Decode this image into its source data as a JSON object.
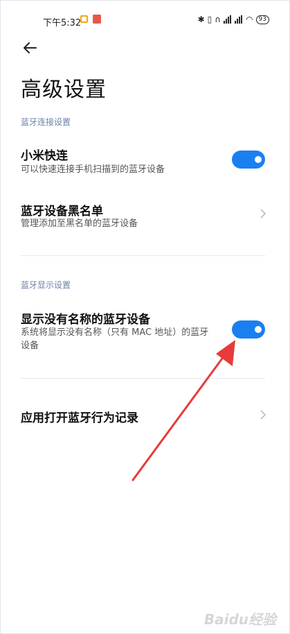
{
  "status_bar": {
    "time": "下午5:32",
    "battery": "93"
  },
  "page": {
    "title": "高级设置"
  },
  "sections": {
    "connect": "蓝牙连接设置",
    "display": "蓝牙显示设置"
  },
  "items": {
    "quick_connect": {
      "title": "小米快连",
      "subtitle": "可以快速连接手机扫描到的蓝牙设备",
      "enabled": true
    },
    "blacklist": {
      "title": "蓝牙设备黑名单",
      "subtitle": "管理添加至黑名单的蓝牙设备"
    },
    "show_unnamed": {
      "title": "显示没有名称的蓝牙设备",
      "subtitle_line1": "系统将显示没有名称（只有 MAC 地址）的蓝牙",
      "subtitle_line2": "设备",
      "enabled": true
    },
    "app_records": {
      "title": "应用打开蓝牙行为记录"
    }
  },
  "colors": {
    "accent": "#1a7ff0",
    "section_text": "#6b7fa6",
    "annotation": "#e83a3a"
  },
  "watermark": "Baidu经验"
}
